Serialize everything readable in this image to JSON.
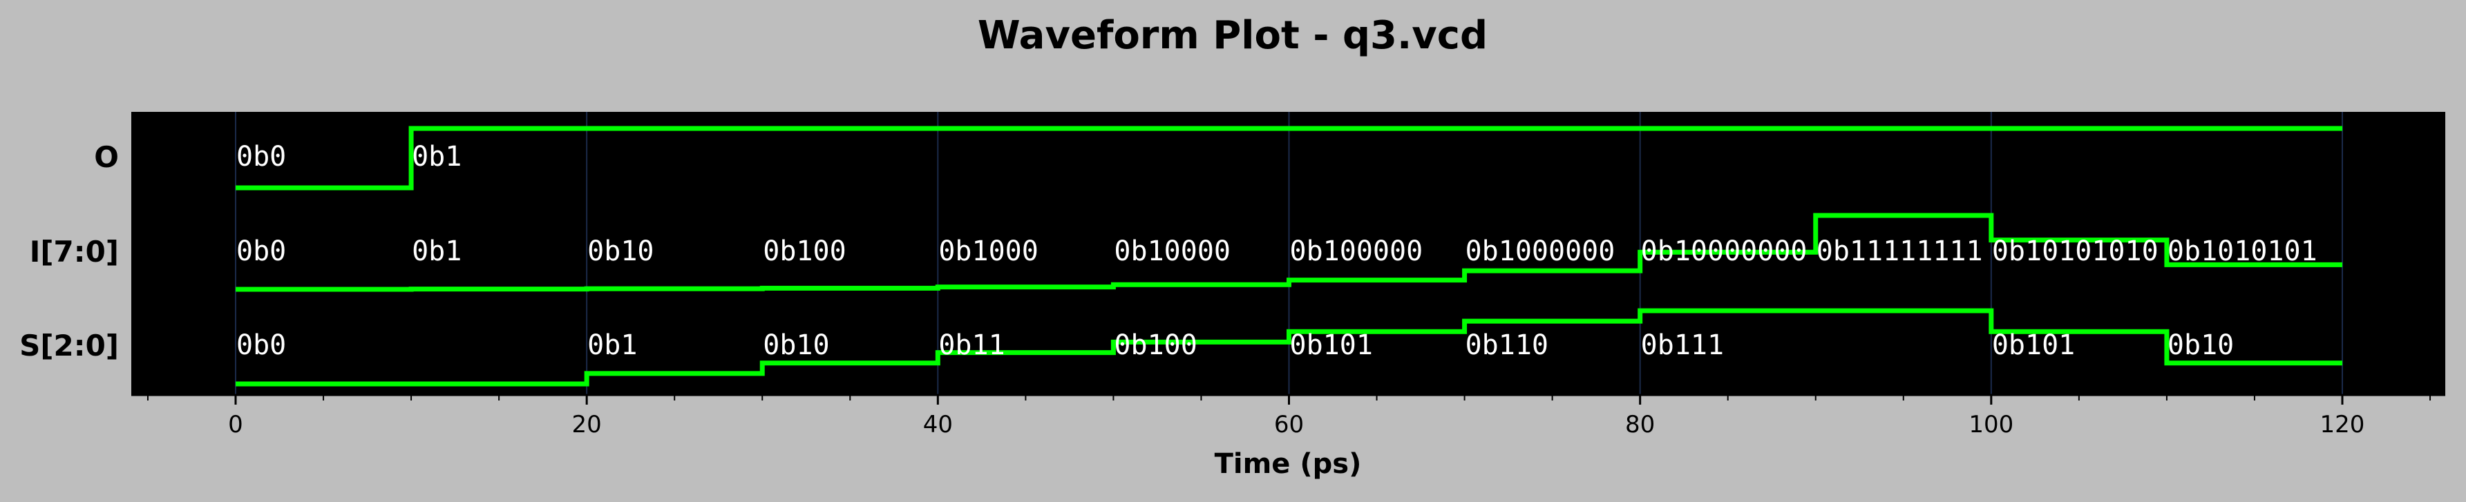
{
  "chart_data": {
    "type": "waveform",
    "title": "Waveform Plot - q3.vcd",
    "xlabel": "Time (ps)",
    "xlim": [
      -15,
      126
    ],
    "xticks": [
      0,
      20,
      40,
      60,
      80,
      100,
      120
    ],
    "grid": true,
    "colors": {
      "background": "#bebebe",
      "plot_background": "#000000",
      "trace": "#00ff00",
      "grid": "#1b2a4a",
      "label_text": "#ffffff"
    },
    "signals": [
      {
        "name": "O",
        "segments": [
          {
            "t": 0,
            "value": "0b0",
            "level": 0
          },
          {
            "t": 10,
            "value": "0b1",
            "level": 1
          }
        ],
        "end": 120
      },
      {
        "name": "I[7:0]",
        "segments": [
          {
            "t": 0,
            "value": "0b0",
            "level": 0
          },
          {
            "t": 10,
            "value": "0b1",
            "level": 1
          },
          {
            "t": 20,
            "value": "0b10",
            "level": 2
          },
          {
            "t": 30,
            "value": "0b100",
            "level": 4
          },
          {
            "t": 40,
            "value": "0b1000",
            "level": 8
          },
          {
            "t": 50,
            "value": "0b10000",
            "level": 16
          },
          {
            "t": 60,
            "value": "0b100000",
            "level": 32
          },
          {
            "t": 70,
            "value": "0b1000000",
            "level": 64
          },
          {
            "t": 80,
            "value": "0b10000000",
            "level": 128
          },
          {
            "t": 90,
            "value": "0b11111111",
            "level": 255
          },
          {
            "t": 100,
            "value": "0b10101010",
            "level": 170
          },
          {
            "t": 110,
            "value": "0b1010101",
            "level": 85
          }
        ],
        "end": 120
      },
      {
        "name": "S[2:0]",
        "segments": [
          {
            "t": 0,
            "value": "0b0",
            "level": 0
          },
          {
            "t": 20,
            "value": "0b1",
            "level": 1
          },
          {
            "t": 30,
            "value": "0b10",
            "level": 2
          },
          {
            "t": 40,
            "value": "0b11",
            "level": 3
          },
          {
            "t": 50,
            "value": "0b100",
            "level": 4
          },
          {
            "t": 60,
            "value": "0b101",
            "level": 5
          },
          {
            "t": 70,
            "value": "0b110",
            "level": 6
          },
          {
            "t": 80,
            "value": "0b111",
            "level": 7
          },
          {
            "t": 100,
            "value": "0b101",
            "level": 5
          },
          {
            "t": 110,
            "value": "0b10",
            "level": 2
          }
        ],
        "end": 120
      }
    ]
  }
}
